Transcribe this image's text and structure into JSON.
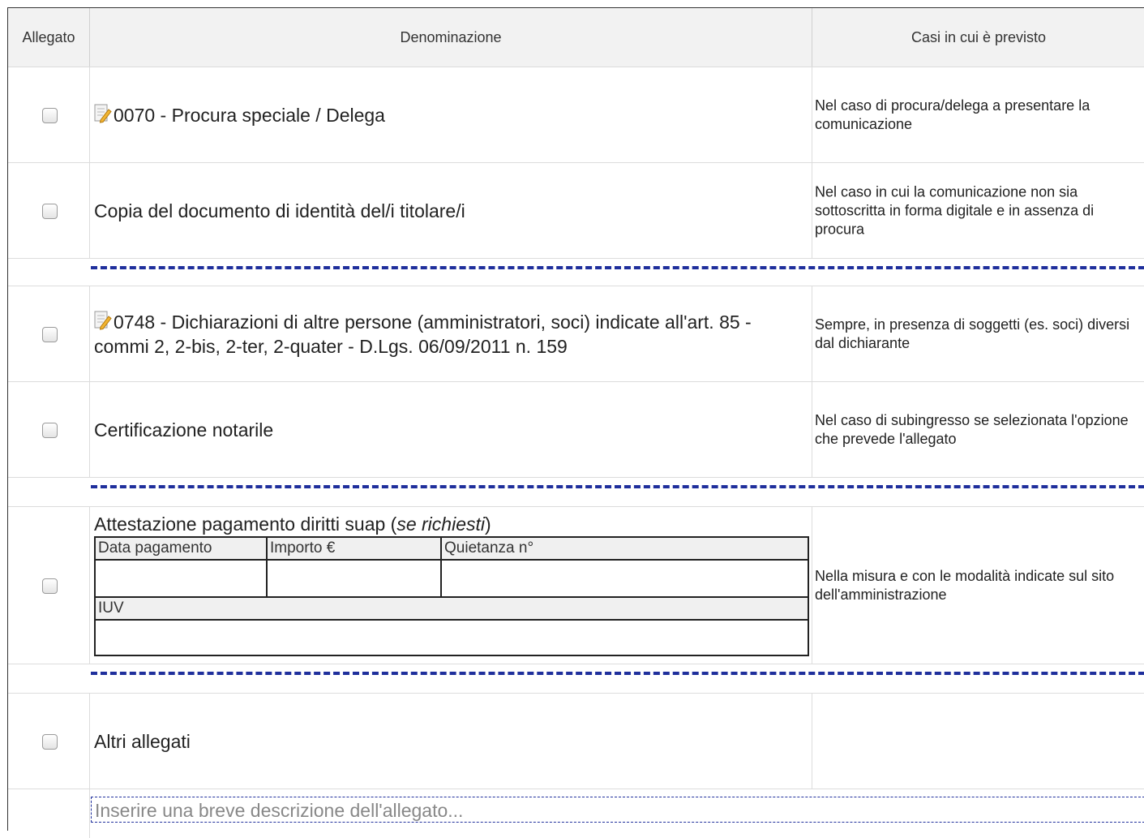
{
  "header": {
    "col_allegato": "Allegato",
    "col_denominazione": "Denominazione",
    "col_casi": "Casi in cui è previsto"
  },
  "rows": [
    {
      "checked": false,
      "has_icon": true,
      "name": "0070 - Procura speciale / Delega",
      "case": "Nel caso di procura/delega a presentare la comunicazione"
    },
    {
      "checked": false,
      "has_icon": false,
      "name": "Copia del documento di identità del/i titolare/i",
      "case": "Nel caso in cui la comunicazione non sia sottoscritta in forma digitale e in assenza di procura"
    },
    {
      "checked": false,
      "has_icon": true,
      "name": "0748 - Dichiarazioni di altre persone (amministratori, soci) indicate all'art. 85 - commi 2, 2-bis, 2-ter, 2-quater - D.Lgs. 06/09/2011 n. 159",
      "case": "Sempre, in presenza di soggetti (es. soci) diversi dal dichiarante"
    },
    {
      "checked": false,
      "has_icon": false,
      "name": "Certificazione notarile",
      "case": "Nel caso di subingresso se selezionata l'opzione che prevede l'allegato"
    }
  ],
  "payment": {
    "checked": false,
    "title": "Attestazione pagamento diritti suap",
    "title_paren_open": " (",
    "title_note": "se richiesti",
    "title_paren_close": ")",
    "label_data": "Data pagamento",
    "label_importo": "Importo €",
    "label_quietanza": "Quietanza n°",
    "label_iuv": "IUV",
    "value_data": "",
    "value_importo": "",
    "value_quietanza": "",
    "value_iuv": "",
    "case": "Nella misura e con le modalità indicate sul sito dell'amministrazione"
  },
  "altri": {
    "checked": false,
    "name": "Altri allegati",
    "case": "",
    "description_placeholder": "Inserire una breve descrizione dell'allegato..."
  },
  "colors": {
    "dashed_separator": "#1f2f9c",
    "header_bg": "#f2f2f2"
  },
  "icons": {
    "document": "edit-document-icon"
  }
}
